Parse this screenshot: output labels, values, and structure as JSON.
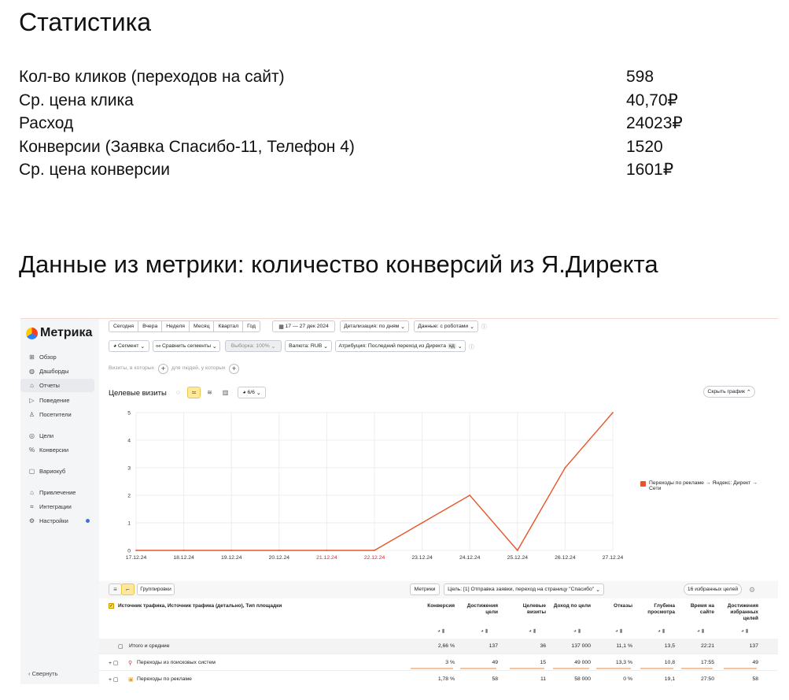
{
  "page": {
    "title": "Статистика",
    "stats": [
      {
        "label": "Кол-во кликов (переходов на сайт)",
        "value": "598"
      },
      {
        "label": "Ср. цена клика",
        "value": "40,70₽"
      },
      {
        "label": "Расход",
        "value": "24023₽"
      },
      {
        "label": "Конверсии (Заявка Спасибо-11, Телефон 4)",
        "value": "1520"
      },
      {
        "label": "Ср. цена конверсии",
        "value": "1601₽"
      }
    ],
    "subtitle": "Данные из метрики: количество конверсий из Я.Директа"
  },
  "metrika": {
    "logo": "Метрика",
    "nav": [
      {
        "label": "Обзор",
        "icon": "grid-icon"
      },
      {
        "label": "Дашборды",
        "icon": "dashboard-icon"
      },
      {
        "label": "Отчеты",
        "icon": "report-icon",
        "active": true
      },
      {
        "label": "Поведение",
        "icon": "behavior-icon"
      },
      {
        "label": "Посетители",
        "icon": "user-icon"
      },
      {
        "label": "Цели",
        "icon": "target-icon"
      },
      {
        "label": "Конверсии",
        "icon": "percent-icon"
      },
      {
        "label": "Вариокуб",
        "icon": "cube-icon"
      },
      {
        "label": "Привлечение",
        "icon": "acquisition-icon"
      },
      {
        "label": "Интеграции",
        "icon": "integration-icon"
      },
      {
        "label": "Настройки",
        "icon": "settings-icon"
      }
    ],
    "collapse": "Свернуть",
    "periods": [
      "Сегодня",
      "Вчера",
      "Неделя",
      "Месяц",
      "Квартал",
      "Год"
    ],
    "date_range": "17 — 27 дек 2024",
    "detail": "Детализация: по дням",
    "data_mode": "Данные: с роботами",
    "segment": "Сегмент",
    "compare": "Сравнить сегменты",
    "sample": "Выборка: 100%",
    "currency": "Валюта: RUB",
    "attribution": "Атрибуция: Последний переход из Директа",
    "attribution_badge": "кд",
    "filter_visits": "Визиты, в которых",
    "filter_people": "для людей, у которых",
    "chart_title": "Целевые визиты",
    "series_count": "6/6",
    "hide_chart": "Скрыть график",
    "legend": "Переходы по рекламе → Яндекс: Директ → Сети",
    "table": {
      "groupings": "Группировки",
      "metrics": "Метрики",
      "goal": "Цель: [1] Отправка заявки, переход на страницу \"Спасибо\"",
      "fav_goals": "16 избранных целей",
      "dims_header": "Источник трафика, Источник трафика (детально), Тип площадки",
      "columns": [
        "Конверсия",
        "Достижения цели",
        "Целевые визиты",
        "Доход по цели",
        "Отказы",
        "Глубина просмотра",
        "Время на сайте",
        "Достижения избранных целей"
      ],
      "rows": [
        {
          "name": "Итого и средние",
          "values": [
            "2,66 %",
            "137",
            "36",
            "137 000",
            "11,1 %",
            "13,5",
            "22:21",
            "137"
          ]
        },
        {
          "name": "Переходы из поисковых систем",
          "values": [
            "3 %",
            "49",
            "15",
            "49 000",
            "13,3 %",
            "10,8",
            "17:55",
            "49"
          ]
        },
        {
          "name": "Переходы по рекламе",
          "values": [
            "1,78 %",
            "58",
            "11",
            "58 000",
            "0 %",
            "19,1",
            "27:50",
            "58"
          ]
        }
      ]
    }
  },
  "chart_data": {
    "type": "line",
    "x": [
      "17.12.24",
      "18.12.24",
      "19.12.24",
      "20.12.24",
      "21.12.24",
      "22.12.24",
      "23.12.24",
      "24.12.24",
      "25.12.24",
      "26.12.24",
      "27.12.24"
    ],
    "weekend_labels": [
      "21.12.24",
      "22.12.24"
    ],
    "series": [
      {
        "name": "Переходы по рекламе → Яндекс: Директ → Сети",
        "values": [
          0,
          0,
          0,
          0,
          0,
          0,
          1,
          2,
          0,
          3,
          5
        ],
        "color": "#e8552a"
      }
    ],
    "yticks": [
      0,
      1,
      2,
      3,
      4,
      5
    ],
    "ylim": [
      0,
      5
    ],
    "grid": true
  }
}
